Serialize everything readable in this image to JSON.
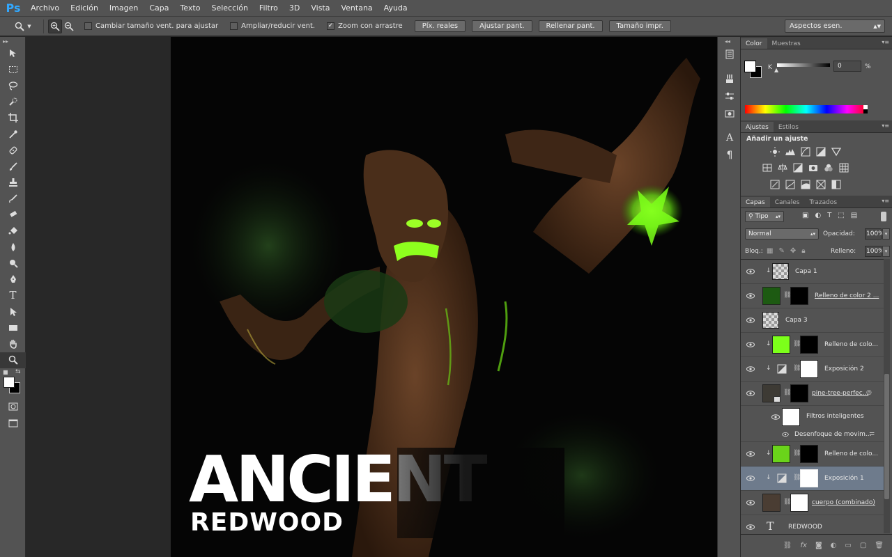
{
  "app": {
    "logo": "Ps"
  },
  "menu": [
    "Archivo",
    "Edición",
    "Imagen",
    "Capa",
    "Texto",
    "Selección",
    "Filtro",
    "3D",
    "Vista",
    "Ventana",
    "Ayuda"
  ],
  "options": {
    "resize_windows": "Cambiar tamaño vent. para ajustar",
    "zoom_all": "Ampliar/reducir vent.",
    "scrubby_zoom": "Zoom con arrastre",
    "resize_windows_checked": false,
    "zoom_all_checked": false,
    "scrubby_zoom_checked": true,
    "buttons": [
      "Píx. reales",
      "Ajustar pant.",
      "Rellenar pant.",
      "Tamaño impr."
    ],
    "workspace": "Aspectos esen."
  },
  "color_panel": {
    "tabs": [
      "Color",
      "Muestras"
    ],
    "channel": "K",
    "value": "0",
    "unit": "%"
  },
  "adjustments_panel": {
    "tabs": [
      "Ajustes",
      "Estilos"
    ],
    "heading": "Añadir un ajuste"
  },
  "layers_panel": {
    "tabs": [
      "Capas",
      "Canales",
      "Trazados"
    ],
    "filter_kind": "Tipo",
    "blend_mode": "Normal",
    "opacity_label": "Opacidad:",
    "opacity_value": "100%",
    "lock_label": "Bloq.:",
    "fill_label": "Relleno:",
    "fill_value": "100%",
    "layers": [
      {
        "name": "Capa 1"
      },
      {
        "name": "Relleno de color 2 ..."
      },
      {
        "name": "Capa 3"
      },
      {
        "name": "Relleno de colo..."
      },
      {
        "name": "Exposición 2"
      },
      {
        "name": "pine-tree-perfec..."
      },
      {
        "name": "Filtros inteligentes"
      },
      {
        "name": "Desenfoque de movim..."
      },
      {
        "name": "Relleno de colo..."
      },
      {
        "name": "Exposición 1"
      },
      {
        "name": "cuerpo (combinado)"
      },
      {
        "name": "REDWOOD"
      }
    ]
  },
  "artwork": {
    "title": "ANCIENT",
    "subtitle": "REDWOOD"
  },
  "colors": {
    "accent_green": "#7cff1a",
    "logo_blue": "#31a8ff",
    "selected_layer": "#6e7b8c"
  }
}
